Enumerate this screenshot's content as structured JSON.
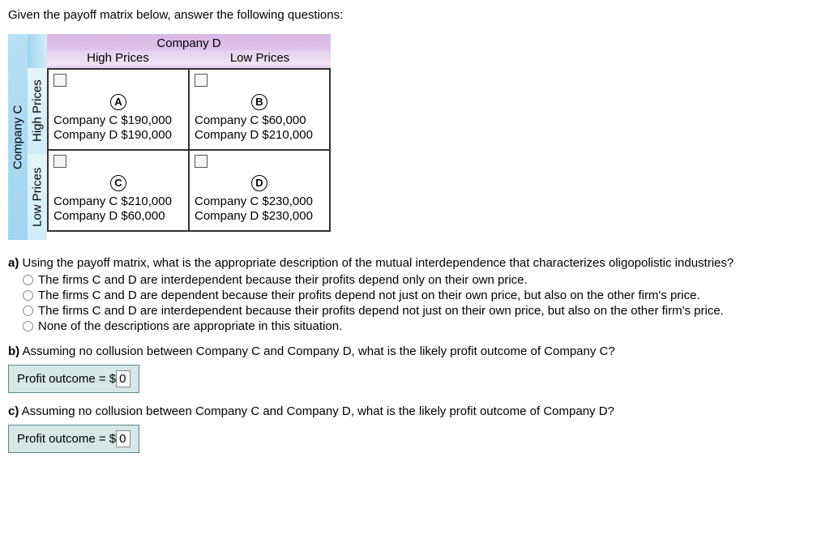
{
  "intro": "Given the payoff matrix below, answer the following questions:",
  "matrix": {
    "rowPlayer": "Company C",
    "colPlayer": "Company D",
    "rowLabels": [
      "High Prices",
      "Low Prices"
    ],
    "colLabels": [
      "High Prices",
      "Low Prices"
    ],
    "cells": {
      "A": {
        "letter": "A",
        "cPayoff": "Company C $190,000",
        "dPayoff": "Company D $190,000"
      },
      "B": {
        "letter": "B",
        "cPayoff": "Company C $60,000",
        "dPayoff": "Company D $210,000"
      },
      "C": {
        "letter": "C",
        "cPayoff": "Company C $210,000",
        "dPayoff": "Company D $60,000"
      },
      "D": {
        "letter": "D",
        "cPayoff": "Company C $230,000",
        "dPayoff": "Company D $230,000"
      }
    }
  },
  "qA": {
    "label": "a)",
    "text": " Using the payoff matrix, what is the appropriate description of the mutual interdependence that characterizes oligopolistic industries?",
    "options": [
      "The firms C and D are interdependent because their profits depend only on their own price.",
      "The firms C and D are dependent because their profits depend not just on their own price, but also on the other firm's price.",
      "The firms C and D are interdependent because their profits depend not just on their own price, but also on the other firm's price.",
      "None of the descriptions are appropriate in this situation."
    ]
  },
  "qB": {
    "label": "b)",
    "text": " Assuming no collusion between Company C and Company D, what is the likely profit outcome of Company C?",
    "answerLabel": "Profit outcome = $",
    "answerValue": "0"
  },
  "qC": {
    "label": "c)",
    "text": " Assuming no collusion between Company C and Company D, what is the likely profit outcome of Company D?",
    "answerLabel": "Profit outcome = $",
    "answerValue": "0"
  }
}
